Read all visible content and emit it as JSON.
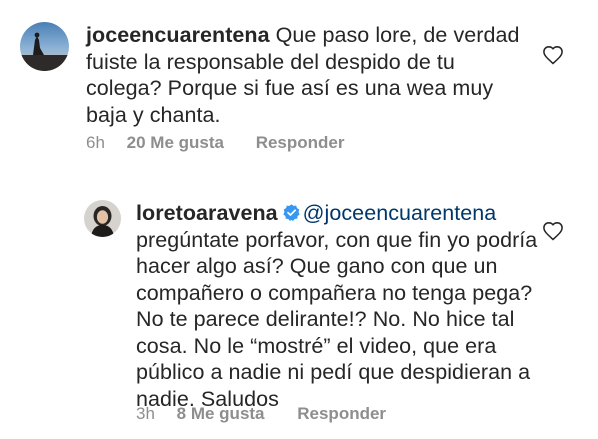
{
  "comments": [
    {
      "username": "joceencuarentena",
      "text": "Que paso lore, de verdad fuiste la responsable del despido de tu colega? Porque si fue así es una wea muy baja y chanta.",
      "time": "6h",
      "likes": "20 Me gusta",
      "reply_label": "Responder",
      "avatar_icon": "profile-photo-sunset-icon",
      "like_icon": "heart-outline-icon"
    },
    {
      "username": "loretoaravena",
      "verified": true,
      "verified_icon": "verified-badge-icon",
      "mention": "@joceencuarentena",
      "text": "pregúntate porfavor, con que fin yo podría hacer algo así? Que gano con que un compañero o compañera no tenga pega? No te parece delirante!? No. No hice tal cosa. No le “mostré” el video, que era público a nadie ni pedí que despidieran a nadie. Saludos",
      "time": "3h",
      "likes": "8 Me gusta",
      "reply_label": "Responder",
      "avatar_icon": "profile-photo-woman-icon",
      "like_icon": "heart-outline-icon"
    }
  ],
  "colors": {
    "text": "#262626",
    "meta": "#8e8e8e",
    "mention": "#00376b",
    "verified": "#3897f0"
  }
}
